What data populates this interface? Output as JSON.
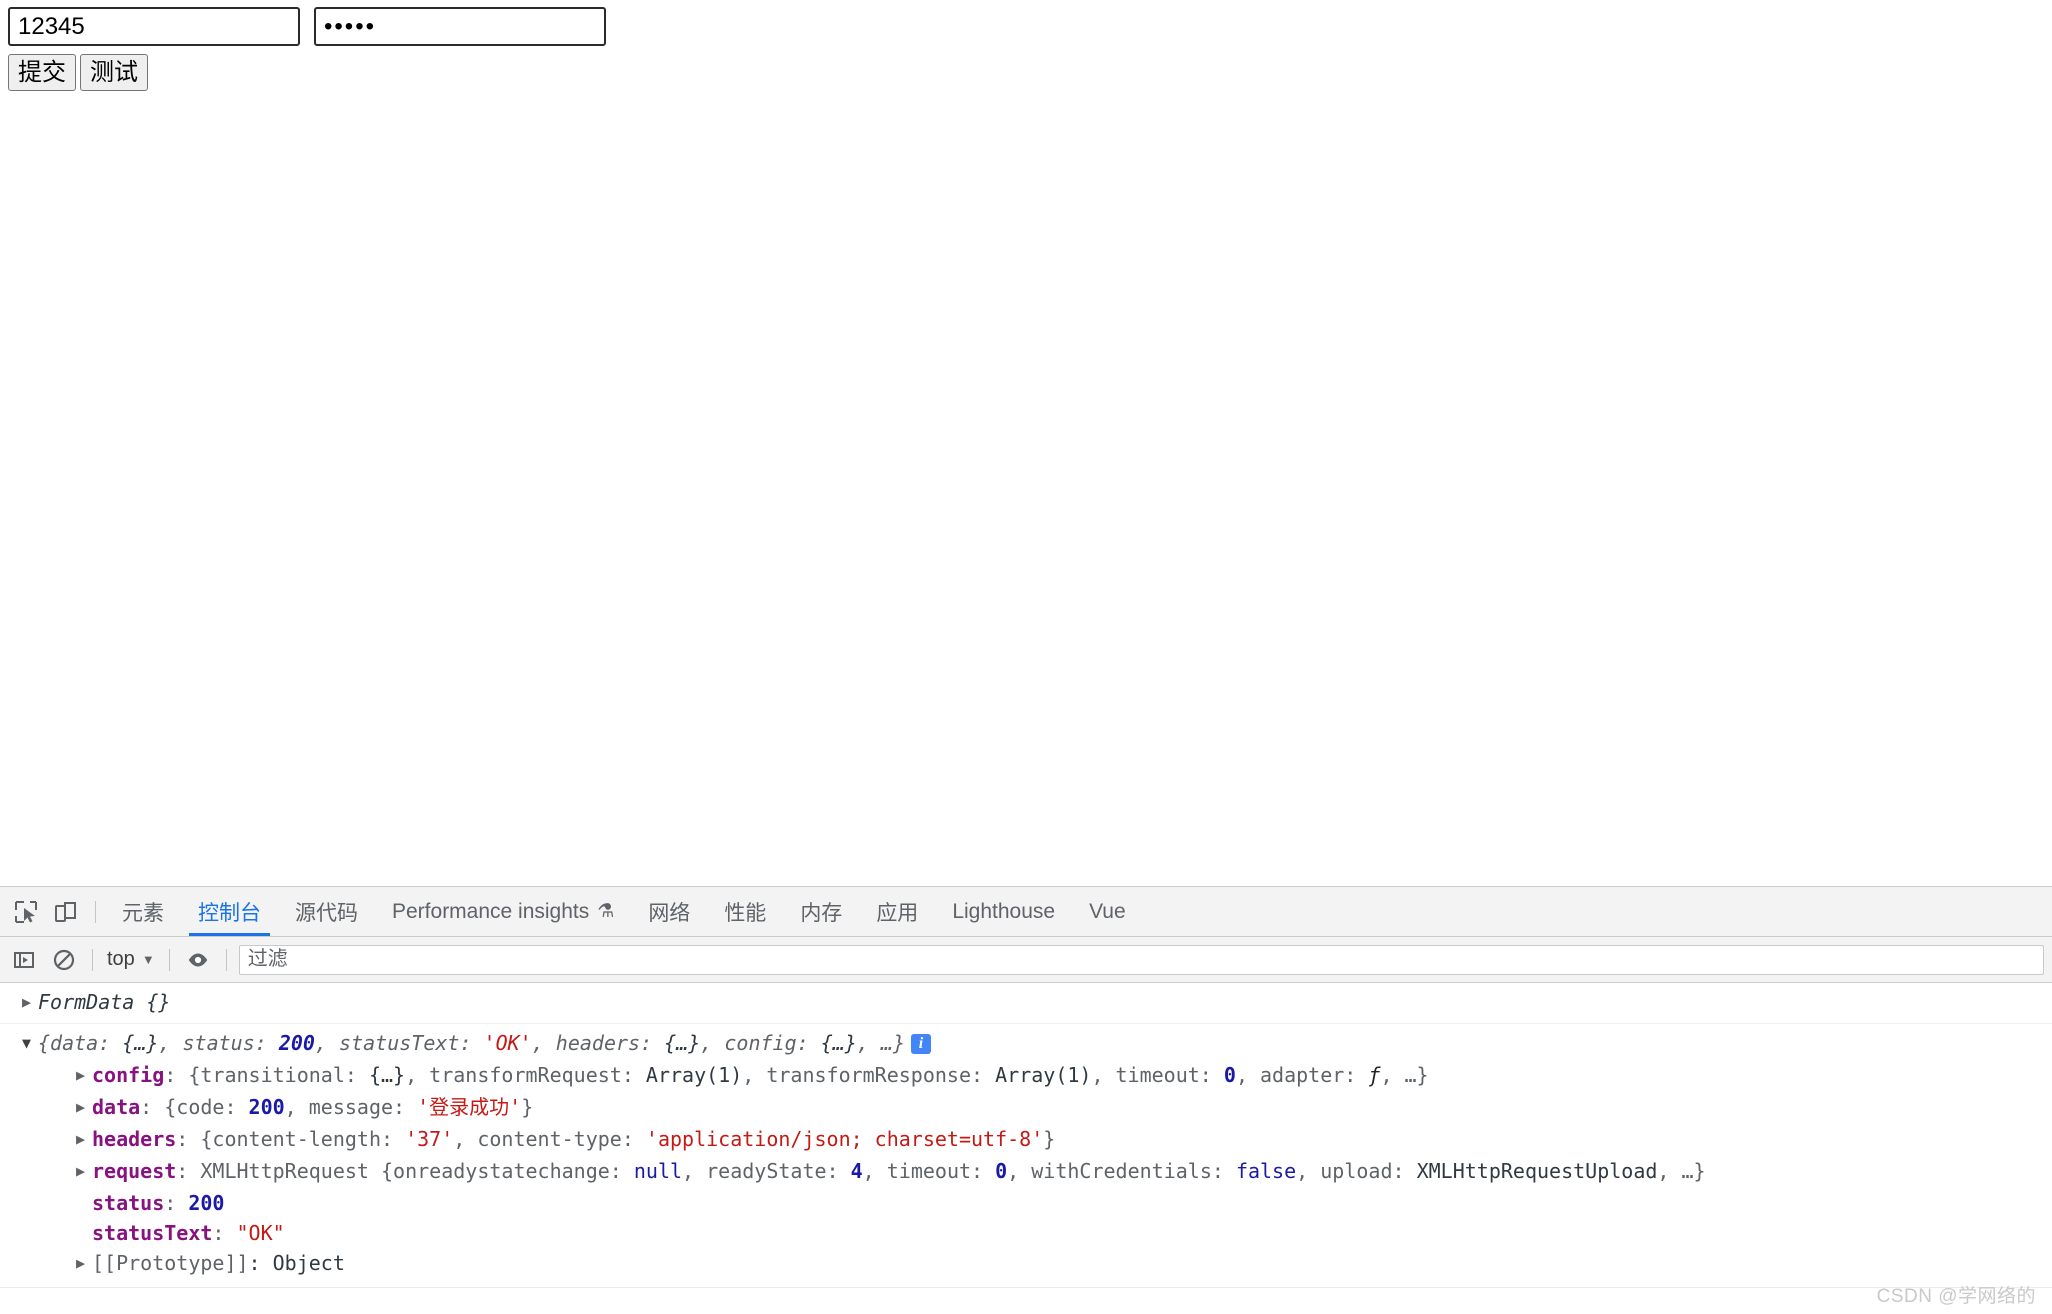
{
  "page": {
    "username_input": {
      "value": "12345",
      "placeholder": ""
    },
    "password_input": {
      "value": "•••••",
      "placeholder": ""
    },
    "submit_button": "提交",
    "test_button": "测试"
  },
  "devtools": {
    "toolbar_icons": {
      "inspect": "inspect-element-icon",
      "device": "device-toolbar-icon"
    },
    "tabs": [
      {
        "label": "元素",
        "active": false
      },
      {
        "label": "控制台",
        "active": true
      },
      {
        "label": "源代码",
        "active": false
      },
      {
        "label": "Performance insights",
        "active": false,
        "suffix": "⚗"
      },
      {
        "label": "网络",
        "active": false
      },
      {
        "label": "性能",
        "active": false
      },
      {
        "label": "内存",
        "active": false
      },
      {
        "label": "应用",
        "active": false
      },
      {
        "label": "Lighthouse",
        "active": false
      },
      {
        "label": "Vue",
        "active": false
      }
    ],
    "filterbar": {
      "sidebar_toggle": "console-sidebar-icon",
      "clear_console": "clear-console-icon",
      "context": "top",
      "context_caret": "▼",
      "eye": "live-expression-icon",
      "filter_placeholder": "过滤",
      "filter_value": ""
    },
    "console": {
      "messages": [
        {
          "type": "formdata",
          "arrow": "▶",
          "name": "FormData",
          "body": "{}"
        },
        {
          "type": "object",
          "arrow": "▼",
          "summary": [
            {
              "t": "{data: ",
              "c": "prop"
            },
            {
              "t": "{…}",
              "c": "plain"
            },
            {
              "t": ", status: ",
              "c": "prop"
            },
            {
              "t": "200",
              "c": "num"
            },
            {
              "t": ", statusText: ",
              "c": "prop"
            },
            {
              "t": "'OK'",
              "c": "str"
            },
            {
              "t": ", headers: ",
              "c": "prop"
            },
            {
              "t": "{…}",
              "c": "plain"
            },
            {
              "t": ", config: ",
              "c": "prop"
            },
            {
              "t": "{…}",
              "c": "plain"
            },
            {
              "t": ", …}",
              "c": "prop"
            }
          ],
          "badge": "i",
          "children": [
            {
              "arrow": "▶",
              "key": "config",
              "parts": [
                {
                  "t": ": {transitional: ",
                  "c": "prop"
                },
                {
                  "t": "{…}",
                  "c": "plain"
                },
                {
                  "t": ", transformRequest: ",
                  "c": "prop"
                },
                {
                  "t": "Array(1)",
                  "c": "plain"
                },
                {
                  "t": ", transformResponse: ",
                  "c": "prop"
                },
                {
                  "t": "Array(1)",
                  "c": "plain"
                },
                {
                  "t": ", timeout: ",
                  "c": "prop"
                },
                {
                  "t": "0",
                  "c": "num"
                },
                {
                  "t": ", adapter: ",
                  "c": "prop"
                },
                {
                  "t": "ƒ",
                  "c": "fn"
                },
                {
                  "t": ", …}",
                  "c": "prop"
                }
              ]
            },
            {
              "arrow": "▶",
              "key": "data",
              "parts": [
                {
                  "t": ": {code: ",
                  "c": "prop"
                },
                {
                  "t": "200",
                  "c": "num"
                },
                {
                  "t": ", message: ",
                  "c": "prop"
                },
                {
                  "t": "'登录成功'",
                  "c": "str"
                },
                {
                  "t": "}",
                  "c": "prop"
                }
              ]
            },
            {
              "arrow": "▶",
              "key": "headers",
              "parts": [
                {
                  "t": ": {content-length: ",
                  "c": "prop"
                },
                {
                  "t": "'37'",
                  "c": "str"
                },
                {
                  "t": ", content-type: ",
                  "c": "prop"
                },
                {
                  "t": "'application/json; charset=utf-8'",
                  "c": "str"
                },
                {
                  "t": "}",
                  "c": "prop"
                }
              ]
            },
            {
              "arrow": "▶",
              "key": "request",
              "parts": [
                {
                  "t": ": XMLHttpRequest {onreadystatechange: ",
                  "c": "prop"
                },
                {
                  "t": "null",
                  "c": "kw"
                },
                {
                  "t": ", readyState: ",
                  "c": "prop"
                },
                {
                  "t": "4",
                  "c": "num"
                },
                {
                  "t": ", timeout: ",
                  "c": "prop"
                },
                {
                  "t": "0",
                  "c": "num"
                },
                {
                  "t": ", withCredentials: ",
                  "c": "prop"
                },
                {
                  "t": "false",
                  "c": "kw"
                },
                {
                  "t": ", upload: ",
                  "c": "prop"
                },
                {
                  "t": "XMLHttpRequestUpload",
                  "c": "plain"
                },
                {
                  "t": ", …}",
                  "c": "prop"
                }
              ]
            },
            {
              "arrow": "",
              "key": "status",
              "parts": [
                {
                  "t": ": ",
                  "c": "prop"
                },
                {
                  "t": "200",
                  "c": "num"
                }
              ]
            },
            {
              "arrow": "",
              "key": "statusText",
              "parts": [
                {
                  "t": ": ",
                  "c": "prop"
                },
                {
                  "t": "\"OK\"",
                  "c": "str"
                }
              ]
            },
            {
              "arrow": "▶",
              "key": "[[Prototype]]",
              "key_class": "proto",
              "parts": [
                {
                  "t": ": Object",
                  "c": "plain"
                }
              ]
            }
          ]
        }
      ]
    }
  },
  "watermark": "CSDN @学网络的",
  "colors": {
    "accent": "#1a73e8",
    "key": "#881280",
    "string": "#c41a16",
    "number": "#1a1aa6",
    "badge": "#4285f4"
  }
}
